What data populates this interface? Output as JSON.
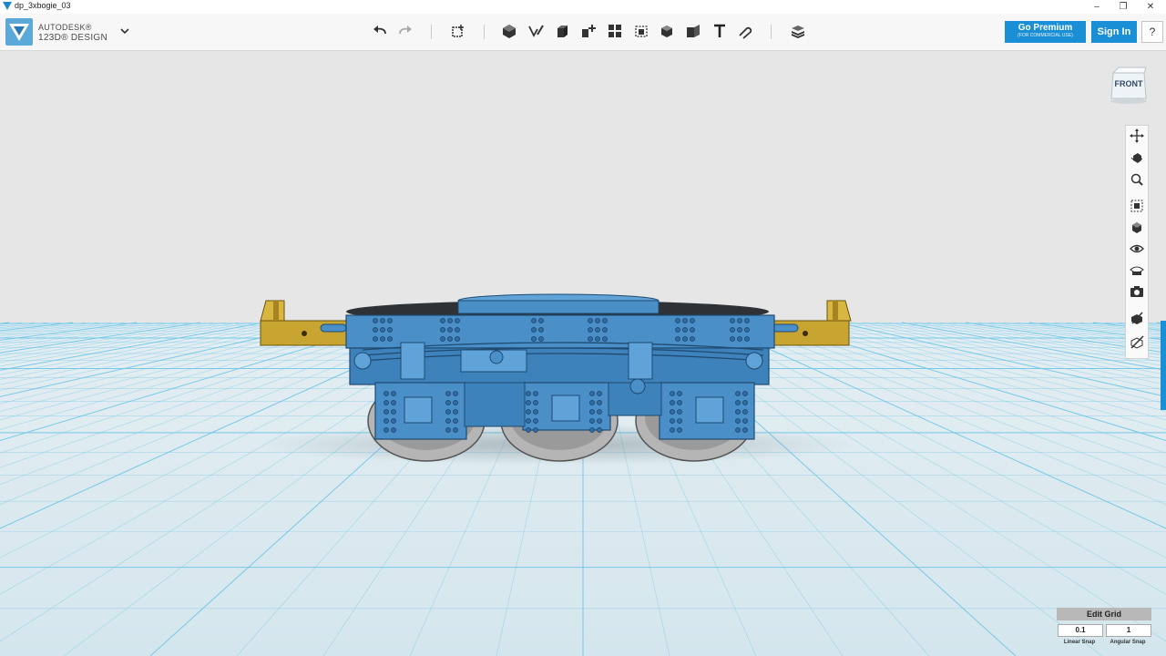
{
  "window": {
    "title": "dp_3xbogie_03",
    "controls": [
      "minimize",
      "maximize",
      "close"
    ]
  },
  "brand": {
    "line1": "AUTODESK®",
    "line2": "123D® DESIGN"
  },
  "toolbar": {
    "tools": [
      "undo-icon",
      "redo-icon",
      "transform-icon",
      "primitives-icon",
      "sketch-icon",
      "construct-icon",
      "modify-icon",
      "pattern-icon",
      "grouping-icon",
      "combine-icon",
      "measure-icon",
      "text-icon",
      "snap-icon",
      "materials-icon"
    ],
    "premium_label": "Go Premium",
    "premium_sub": "(FOR COMMERCIAL USE)",
    "signin_label": "Sign In",
    "help_label": "?"
  },
  "viewcube": {
    "label": "FRONT"
  },
  "navbar": {
    "tools": [
      "pan-icon",
      "orbit-icon",
      "zoom-icon",
      "fit-icon",
      "views-icon",
      "visibility-icon",
      "display-mode-icon",
      "camera-icon",
      "material-toggle-icon",
      "hide-icon"
    ]
  },
  "grid": {
    "edit_label": "Edit Grid",
    "linear_snap": "0.1",
    "angular_snap": "1",
    "linear_label": "Linear Snap",
    "angular_label": "Angular Snap"
  },
  "colors": {
    "accent": "#1a8fd5",
    "model_blue": "#4a8fc8",
    "model_dark": "#2a5e8c",
    "gold": "#c8a530",
    "grid_line": "#6ec4e6",
    "floor": "#dbe9ee",
    "background": "#e6e6e6"
  }
}
